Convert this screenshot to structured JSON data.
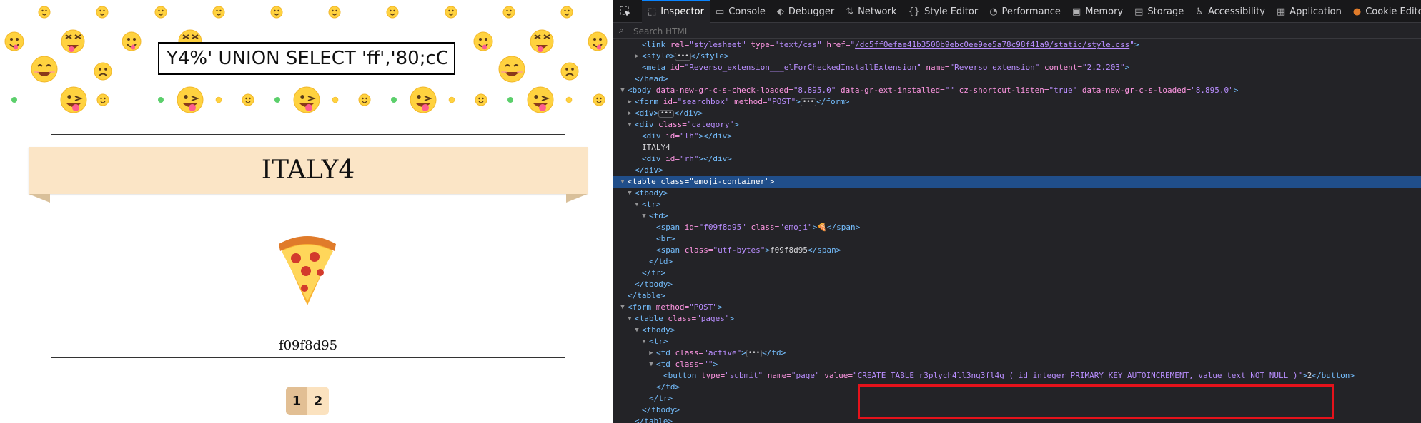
{
  "page": {
    "search_value": "Y4%' UNION SELECT 'ff','80;cC",
    "category_title": "ITALY4",
    "emoji_code": "f09f8d95",
    "pages": [
      "1",
      "2"
    ],
    "colors": {
      "ribbon": "#fbe5c6",
      "active_page": "#e2bf94",
      "page": "#fbe2bf"
    }
  },
  "devtools": {
    "tabs": [
      {
        "label": "Inspector",
        "icon": "inspector-icon"
      },
      {
        "label": "Console",
        "icon": "console-icon"
      },
      {
        "label": "Debugger",
        "icon": "debugger-icon"
      },
      {
        "label": "Network",
        "icon": "network-icon"
      },
      {
        "label": "Style Editor",
        "icon": "style-editor-icon"
      },
      {
        "label": "Performance",
        "icon": "performance-icon"
      },
      {
        "label": "Memory",
        "icon": "memory-icon"
      },
      {
        "label": "Storage",
        "icon": "storage-icon"
      },
      {
        "label": "Accessibility",
        "icon": "accessibility-icon"
      },
      {
        "label": "Application",
        "icon": "application-icon"
      },
      {
        "label": "Cookie Editor",
        "icon": "cookie-icon"
      }
    ],
    "search_placeholder": "Search HTML",
    "lines": [
      {
        "indent": 3,
        "tw": "",
        "parts": [
          [
            "tag",
            "<link "
          ],
          [
            "attr",
            "rel="
          ],
          [
            "val",
            "\"stylesheet\""
          ],
          [
            "attr",
            " type="
          ],
          [
            "val",
            "\"text/css\""
          ],
          [
            "attr",
            " href="
          ],
          [
            "val",
            "\""
          ],
          [
            "link",
            "/dc5ff0efae41b3500b9ebc0ee9ee5a78c98f41a9/static/style.css"
          ],
          [
            "val",
            "\""
          ],
          [
            "tag",
            ">"
          ]
        ]
      },
      {
        "indent": 3,
        "tw": "▶",
        "parts": [
          [
            "tag",
            "<style>"
          ],
          [
            "ell",
            "•••"
          ],
          [
            "tag",
            "</style>"
          ]
        ]
      },
      {
        "indent": 3,
        "tw": "",
        "parts": [
          [
            "tag",
            "<meta "
          ],
          [
            "attr",
            "id="
          ],
          [
            "val",
            "\"Reverso_extension___elForCheckedInstallExtension\""
          ],
          [
            "attr",
            " name="
          ],
          [
            "val",
            "\"Reverso extension\""
          ],
          [
            "attr",
            " content="
          ],
          [
            "val",
            "\"2.2.203\""
          ],
          [
            "tag",
            ">"
          ]
        ]
      },
      {
        "indent": 2,
        "tw": "",
        "parts": [
          [
            "tag",
            "</head>"
          ]
        ]
      },
      {
        "indent": 1,
        "tw": "▼",
        "parts": [
          [
            "tag",
            "<body "
          ],
          [
            "attr",
            "data-new-gr-c-s-check-loaded="
          ],
          [
            "val",
            "\"8.895.0\""
          ],
          [
            "attr",
            " data-gr-ext-installed="
          ],
          [
            "val",
            "\"\""
          ],
          [
            "attr",
            " cz-shortcut-listen="
          ],
          [
            "val",
            "\"true\""
          ],
          [
            "attr",
            " data-new-gr-c-s-loaded="
          ],
          [
            "val",
            "\"8.895.0\""
          ],
          [
            "tag",
            ">"
          ]
        ]
      },
      {
        "indent": 2,
        "tw": "▶",
        "parts": [
          [
            "tag",
            "<form "
          ],
          [
            "attr",
            "id="
          ],
          [
            "val",
            "\"searchbox\""
          ],
          [
            "attr",
            " method="
          ],
          [
            "val",
            "\"POST\""
          ],
          [
            "tag",
            ">"
          ],
          [
            "ell",
            "•••"
          ],
          [
            "tag",
            "</form>"
          ]
        ]
      },
      {
        "indent": 2,
        "tw": "▶",
        "parts": [
          [
            "tag",
            "<div>"
          ],
          [
            "ell",
            "•••"
          ],
          [
            "tag",
            "</div>"
          ]
        ]
      },
      {
        "indent": 2,
        "tw": "▼",
        "parts": [
          [
            "tag",
            "<div "
          ],
          [
            "attr",
            "class="
          ],
          [
            "val",
            "\"category\""
          ],
          [
            "tag",
            ">"
          ]
        ]
      },
      {
        "indent": 3,
        "tw": "",
        "parts": [
          [
            "tag",
            "<div "
          ],
          [
            "attr",
            "id="
          ],
          [
            "val",
            "\"lh\""
          ],
          [
            "tag",
            "></div>"
          ]
        ]
      },
      {
        "indent": 3,
        "tw": "",
        "parts": [
          [
            "plain",
            "ITALY4"
          ]
        ]
      },
      {
        "indent": 3,
        "tw": "",
        "parts": [
          [
            "tag",
            "<div "
          ],
          [
            "attr",
            "id="
          ],
          [
            "val",
            "\"rh\""
          ],
          [
            "tag",
            "></div>"
          ]
        ]
      },
      {
        "indent": 2,
        "tw": "",
        "parts": [
          [
            "tag",
            "</div>"
          ]
        ]
      },
      {
        "indent": 1,
        "tw": "▼",
        "sel": true,
        "parts": [
          [
            "tag",
            "<table "
          ],
          [
            "attr",
            "class="
          ],
          [
            "val",
            "\"emoji-container\""
          ],
          [
            "tag",
            ">"
          ]
        ]
      },
      {
        "indent": 2,
        "tw": "▼",
        "parts": [
          [
            "tag",
            "<tbody>"
          ]
        ]
      },
      {
        "indent": 3,
        "tw": "▼",
        "parts": [
          [
            "tag",
            "<tr>"
          ]
        ]
      },
      {
        "indent": 4,
        "tw": "▼",
        "parts": [
          [
            "tag",
            "<td>"
          ]
        ]
      },
      {
        "indent": 5,
        "tw": "",
        "parts": [
          [
            "tag",
            "<span "
          ],
          [
            "attr",
            "id="
          ],
          [
            "val",
            "\"f09f8d95\""
          ],
          [
            "attr",
            " class="
          ],
          [
            "val",
            "\"emoji\""
          ],
          [
            "tag",
            ">"
          ],
          [
            "plain",
            "🍕"
          ],
          [
            "tag",
            "</span>"
          ]
        ]
      },
      {
        "indent": 5,
        "tw": "",
        "parts": [
          [
            "tag",
            "<br>"
          ]
        ]
      },
      {
        "indent": 5,
        "tw": "",
        "parts": [
          [
            "tag",
            "<span "
          ],
          [
            "attr",
            "class="
          ],
          [
            "val",
            "\"utf-bytes\""
          ],
          [
            "tag",
            ">"
          ],
          [
            "plain",
            "f09f8d95"
          ],
          [
            "tag",
            "</span>"
          ]
        ]
      },
      {
        "indent": 4,
        "tw": "",
        "parts": [
          [
            "tag",
            "</td>"
          ]
        ]
      },
      {
        "indent": 3,
        "tw": "",
        "parts": [
          [
            "tag",
            "</tr>"
          ]
        ]
      },
      {
        "indent": 2,
        "tw": "",
        "parts": [
          [
            "tag",
            "</tbody>"
          ]
        ]
      },
      {
        "indent": 1,
        "tw": "",
        "parts": [
          [
            "tag",
            "</table>"
          ]
        ]
      },
      {
        "indent": 1,
        "tw": "▼",
        "parts": [
          [
            "tag",
            "<form "
          ],
          [
            "attr",
            "method="
          ],
          [
            "val",
            "\"POST\""
          ],
          [
            "tag",
            ">"
          ]
        ]
      },
      {
        "indent": 2,
        "tw": "▼",
        "parts": [
          [
            "tag",
            "<table "
          ],
          [
            "attr",
            "class="
          ],
          [
            "val",
            "\"pages\""
          ],
          [
            "tag",
            ">"
          ]
        ]
      },
      {
        "indent": 3,
        "tw": "▼",
        "parts": [
          [
            "tag",
            "<tbody>"
          ]
        ]
      },
      {
        "indent": 4,
        "tw": "▼",
        "parts": [
          [
            "tag",
            "<tr>"
          ]
        ]
      },
      {
        "indent": 5,
        "tw": "▶",
        "parts": [
          [
            "tag",
            "<td "
          ],
          [
            "attr",
            "class="
          ],
          [
            "val",
            "\"active\""
          ],
          [
            "tag",
            ">"
          ],
          [
            "ell",
            "•••"
          ],
          [
            "tag",
            "</td>"
          ]
        ]
      },
      {
        "indent": 5,
        "tw": "▼",
        "parts": [
          [
            "tag",
            "<td "
          ],
          [
            "attr",
            "class="
          ],
          [
            "val",
            "\"\""
          ],
          [
            "tag",
            ">"
          ]
        ]
      },
      {
        "indent": 6,
        "tw": "",
        "parts": [
          [
            "tag",
            "<button "
          ],
          [
            "attr",
            "type="
          ],
          [
            "val",
            "\"submit\""
          ],
          [
            "attr",
            " name="
          ],
          [
            "val",
            "\"page\""
          ],
          [
            "attr",
            " value="
          ],
          [
            "val",
            "\"CREATE TABLE r3plych4ll3ng3fl4g ( id integer PRIMARY KEY AUTOINCREMENT, value text NOT NULL )\""
          ],
          [
            "tag",
            ">"
          ],
          [
            "plain",
            "2"
          ],
          [
            "tag",
            "</button>"
          ]
        ]
      },
      {
        "indent": 5,
        "tw": "",
        "parts": [
          [
            "tag",
            "</td>"
          ]
        ]
      },
      {
        "indent": 4,
        "tw": "",
        "parts": [
          [
            "tag",
            "</tr>"
          ]
        ]
      },
      {
        "indent": 3,
        "tw": "",
        "parts": [
          [
            "tag",
            "</tbody>"
          ]
        ]
      },
      {
        "indent": 2,
        "tw": "",
        "parts": [
          [
            "tag",
            "</table>"
          ]
        ]
      }
    ]
  }
}
